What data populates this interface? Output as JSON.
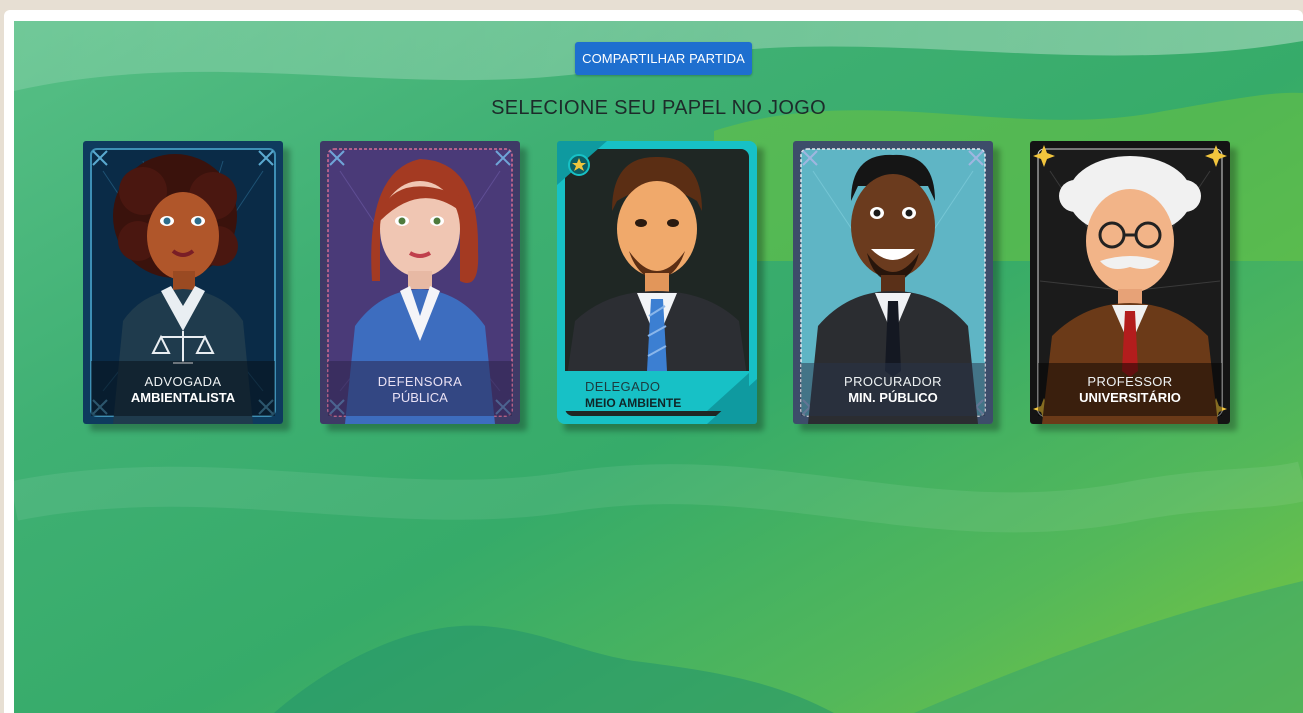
{
  "toolbar": {
    "share_label": "COMPARTILHAR PARTIDA"
  },
  "heading": "SELECIONE SEU PAPEL NO JOGO",
  "roles": [
    {
      "line1": "ADVOGADA",
      "line2": "AMBIENTALISTA",
      "icon": "scales-icon",
      "selected": false
    },
    {
      "line1": "DEFENSORA",
      "line2": "PÚBLICA",
      "icon": "",
      "selected": false
    },
    {
      "line1": "DELEGADO",
      "line2": "MEIO AMBIENTE",
      "icon": "star-badge-icon",
      "selected": true
    },
    {
      "line1": "PROCURADOR",
      "line2": "MIN. PÚBLICO",
      "icon": "",
      "selected": false
    },
    {
      "line1": "PROFESSOR",
      "line2": "UNIVERSITÁRIO",
      "icon": "sparkle-icon",
      "selected": false
    }
  ],
  "colors": {
    "button": "#1e6fcf",
    "card_advogada": "#0e3b5e",
    "card_defensora": "#3e3a66",
    "card_delegado": "#17c1c6",
    "card_procurador": "#3d4d6a",
    "card_professor": "#141414",
    "accent_gold": "#f2c53d"
  }
}
